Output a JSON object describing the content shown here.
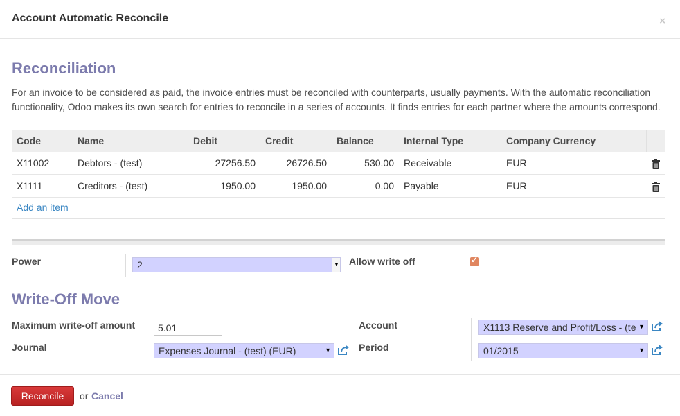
{
  "dialog": {
    "title": "Account Automatic Reconcile",
    "close_label": "×"
  },
  "reconciliation": {
    "title": "Reconciliation",
    "description": "For an invoice to be considered as paid, the invoice entries must be reconciled with counterparts, usually payments. With the automatic reconciliation functionality, Odoo makes its own search for entries to reconcile in a series of accounts. It finds entries for each partner where the amounts correspond.",
    "columns": [
      "Code",
      "Name",
      "Debit",
      "Credit",
      "Balance",
      "Internal Type",
      "Company Currency"
    ],
    "rows": [
      {
        "code": "X11002",
        "name": "Debtors - (test)",
        "debit": "27256.50",
        "credit": "26726.50",
        "balance": "530.00",
        "internal_type": "Receivable",
        "currency": "EUR"
      },
      {
        "code": "X1111",
        "name": "Creditors - (test)",
        "debit": "1950.00",
        "credit": "1950.00",
        "balance": "0.00",
        "internal_type": "Payable",
        "currency": "EUR"
      }
    ],
    "add_item": "Add an item"
  },
  "options": {
    "power_label": "Power",
    "power_value": "2",
    "allow_write_off_label": "Allow write off",
    "allow_write_off_checked": true
  },
  "writeoff": {
    "title": "Write-Off Move",
    "max_amount_label": "Maximum write-off amount",
    "max_amount_value": "5.01",
    "journal_label": "Journal",
    "journal_value": "Expenses Journal - (test) (EUR)",
    "account_label": "Account",
    "account_value": "X1113 Reserve and Profit/Loss - (te",
    "period_label": "Period",
    "period_value": "01/2015"
  },
  "footer": {
    "reconcile_label": "Reconcile",
    "or_text": "or",
    "cancel_label": "Cancel"
  },
  "colors": {
    "accent": "#7c7bad",
    "primary_button": "#c62828",
    "link": "#3b87c3",
    "select_bg": "#d2d2ff",
    "checkbox": "#e08660"
  },
  "icons": {
    "delete": "trash-icon",
    "external": "external-link-icon",
    "dropdown": "caret-down-icon"
  }
}
